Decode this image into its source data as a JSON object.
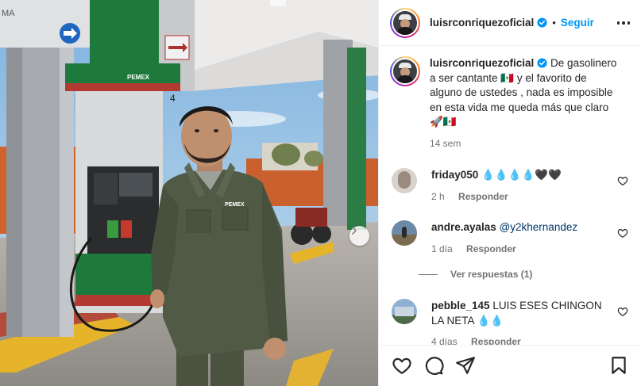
{
  "post": {
    "username": "luisrconriquezoficial",
    "follow_label": "Seguir",
    "separator": "•"
  },
  "caption": {
    "username": "luisrconriquezoficial",
    "text": "De gasolinero a ser cantante 🇲🇽 y el favorito de alguno de ustedes , nada es imposible en esta vida me queda más que claro 🚀🇲🇽",
    "time": "14 sem"
  },
  "comments": [
    {
      "username": "friday050",
      "text": "💧💧💧💧🖤🖤",
      "time": "2 h",
      "reply_label": "Responder"
    },
    {
      "username": "andre.ayalas",
      "text": "@y2khernandez",
      "time": "1 día",
      "reply_label": "Responder"
    },
    {
      "username": "pebble_145",
      "text": "LUIS ESES CHINGON LA NETA 💧💧",
      "time": "4 días",
      "reply_label": "Responder"
    }
  ],
  "view_replies": "Ver respuestas (1)",
  "photo": {
    "pemex_label": "PEMEX",
    "pump_number": "4"
  },
  "colors": {
    "accent_blue": "#0095f6",
    "verified_blue": "#0095f6",
    "text_primary": "#262626",
    "text_secondary": "#737373",
    "pemex_green": "#1e7a3c"
  },
  "icons": {
    "next": "chevron-right-icon",
    "more": "more-options-icon",
    "like": "heart-icon",
    "comment": "comment-icon",
    "share": "share-icon",
    "save": "bookmark-icon",
    "verified": "verified-badge-icon"
  }
}
